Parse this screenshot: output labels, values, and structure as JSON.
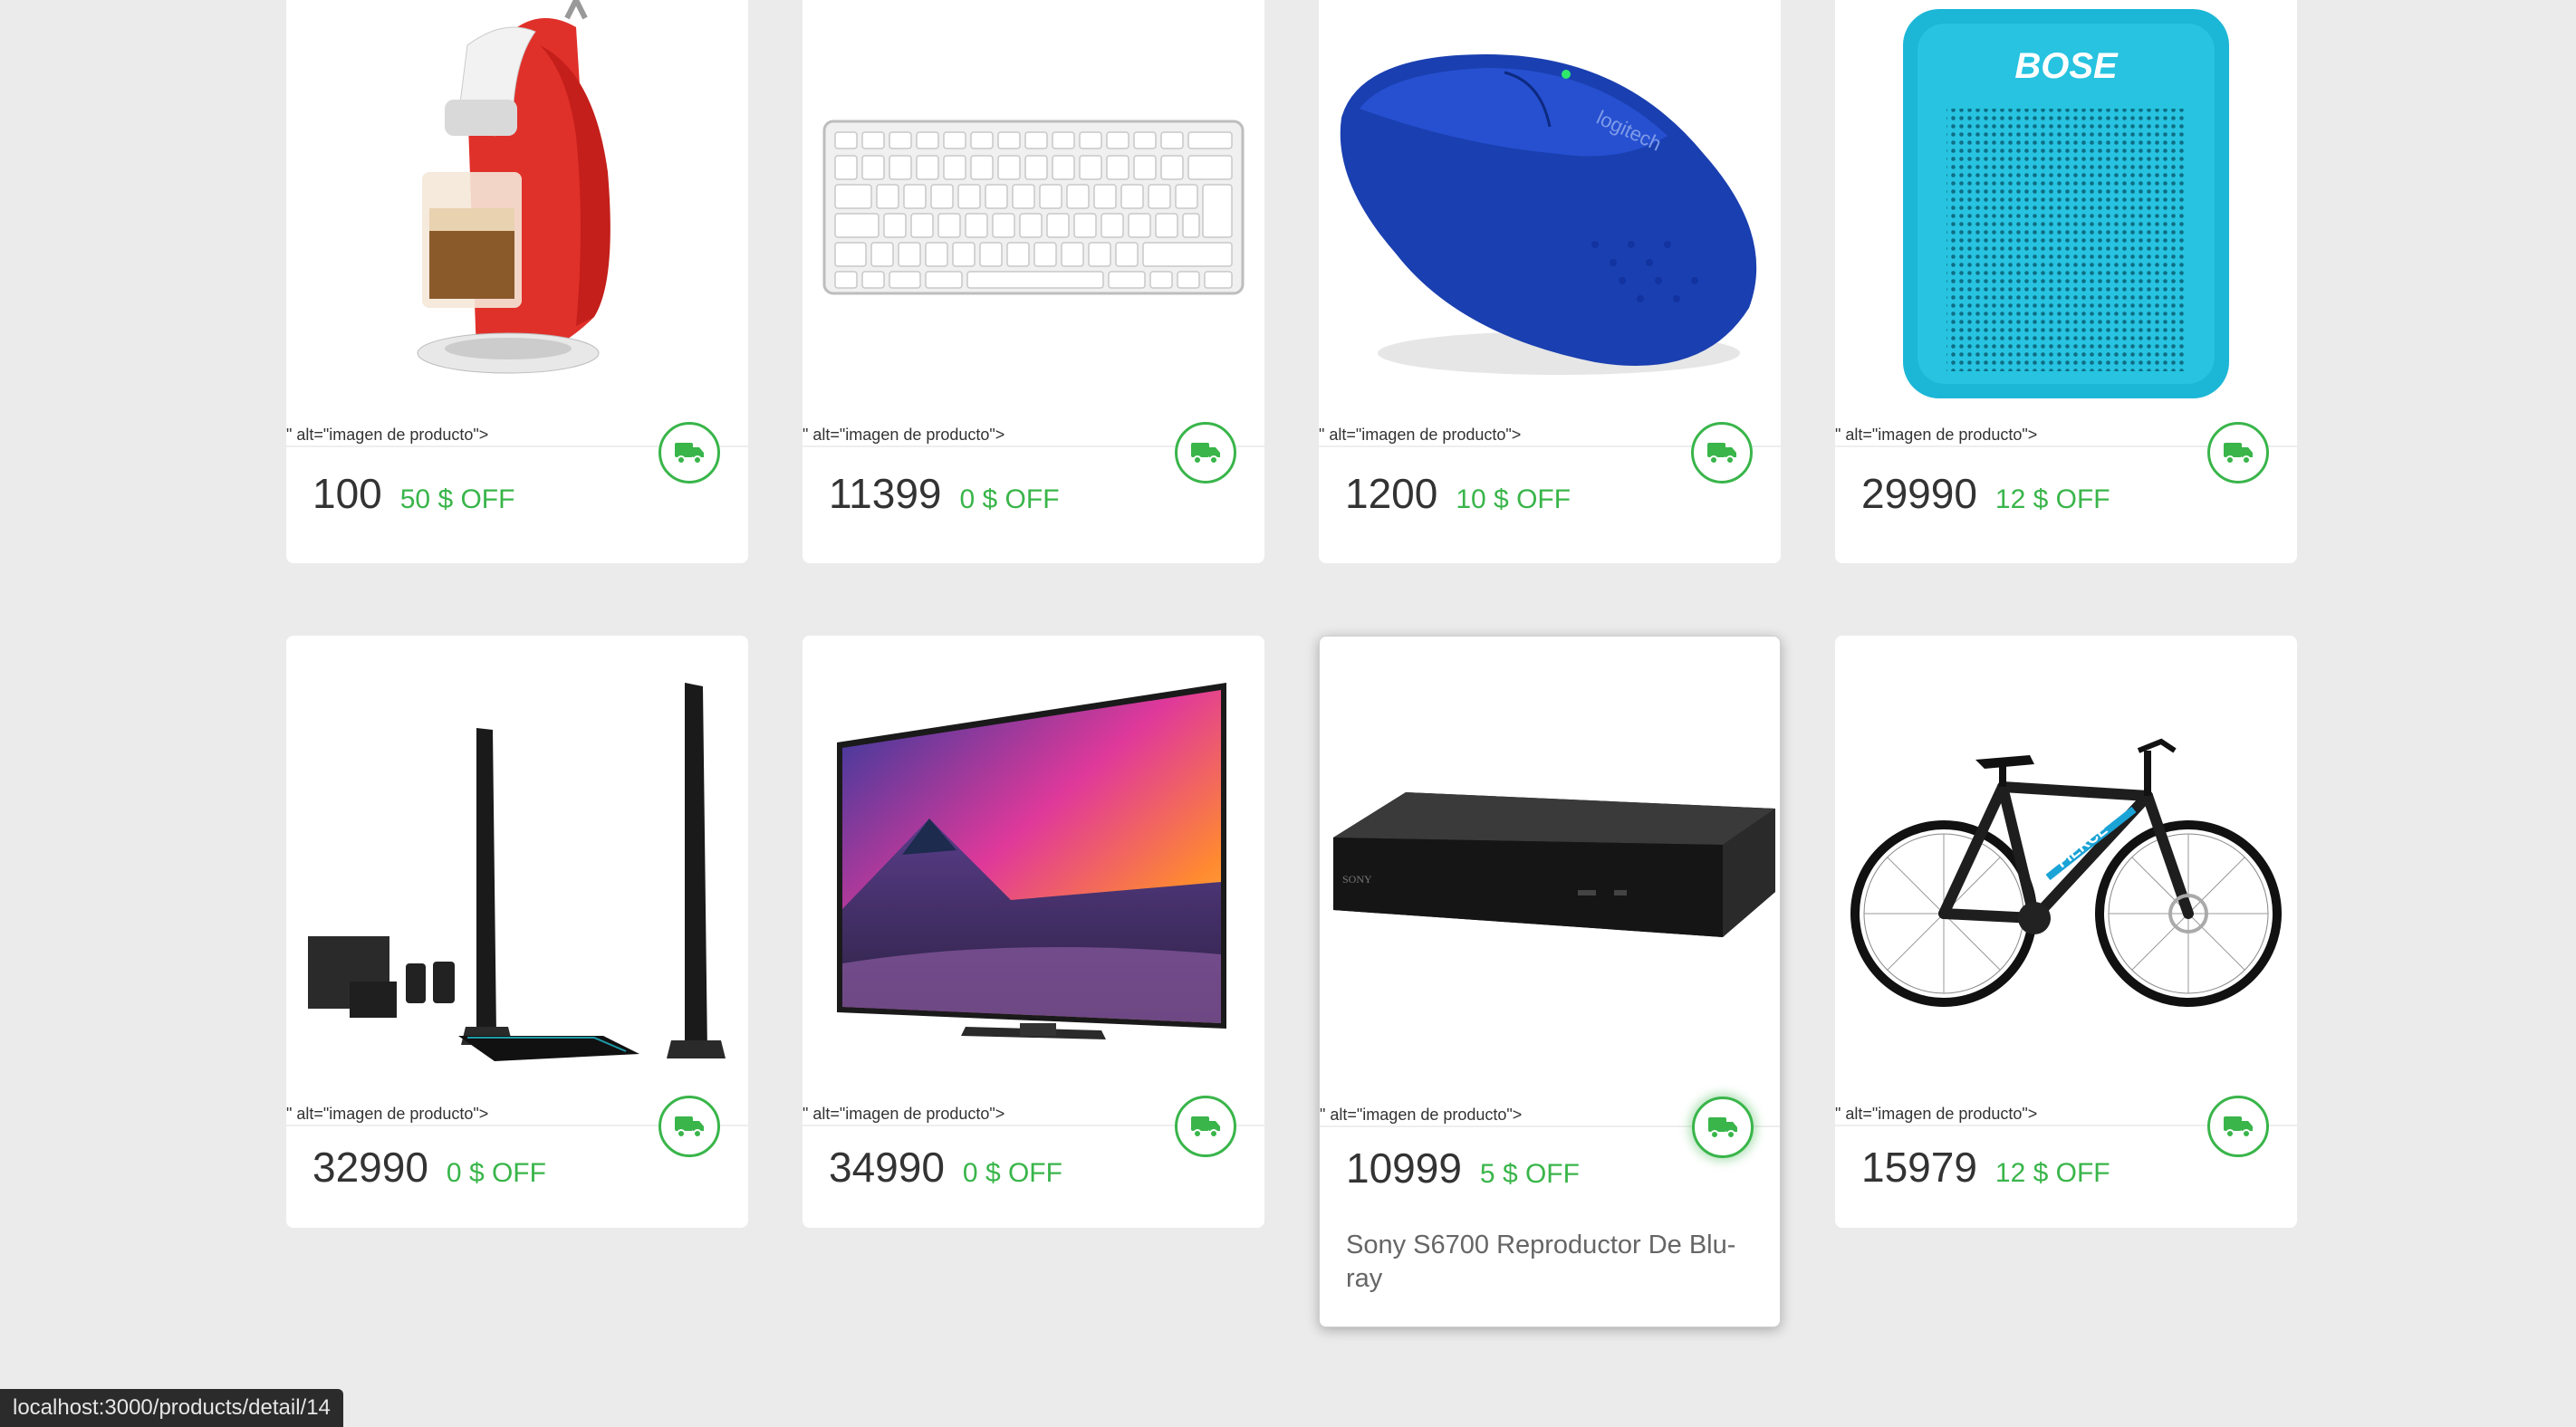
{
  "products": [
    {
      "price": "100",
      "discount": "50 $ OFF",
      "alt": "\" alt=\"imagen de producto\">",
      "image": "coffee-maker"
    },
    {
      "price": "11399",
      "discount": "0 $ OFF",
      "alt": "\" alt=\"imagen de producto\">",
      "image": "keyboard"
    },
    {
      "price": "1200",
      "discount": "10 $ OFF",
      "alt": "\" alt=\"imagen de producto\">",
      "image": "mouse",
      "brand_text": "logitech"
    },
    {
      "price": "29990",
      "discount": "12 $ OFF",
      "alt": "\" alt=\"imagen de producto\">",
      "image": "speaker",
      "brand_text": "BOSE"
    },
    {
      "price": "32990",
      "discount": "0 $ OFF",
      "alt": "\" alt=\"imagen de producto\">",
      "image": "home-theater"
    },
    {
      "price": "34990",
      "discount": "0 $ OFF",
      "alt": "\" alt=\"imagen de producto\">",
      "image": "tv"
    },
    {
      "price": "10999",
      "discount": "5 $ OFF",
      "alt": "\" alt=\"imagen de producto\">",
      "image": "bluray-player",
      "brand_text": "SONY",
      "name": "Sony S6700 Reproductor De Blu-ray",
      "hovered": true
    },
    {
      "price": "15979",
      "discount": "12 $ OFF",
      "alt": "\" alt=\"imagen de producto\">",
      "image": "bicycle",
      "brand_text": "FIERCE"
    }
  ],
  "status_bar": {
    "url": "localhost:3000/products/detail/14"
  },
  "icons": {
    "shipping": "truck-icon"
  },
  "colors": {
    "accent_green": "#39b54a",
    "background": "#ebebeb",
    "card": "#ffffff",
    "text": "#333333"
  }
}
